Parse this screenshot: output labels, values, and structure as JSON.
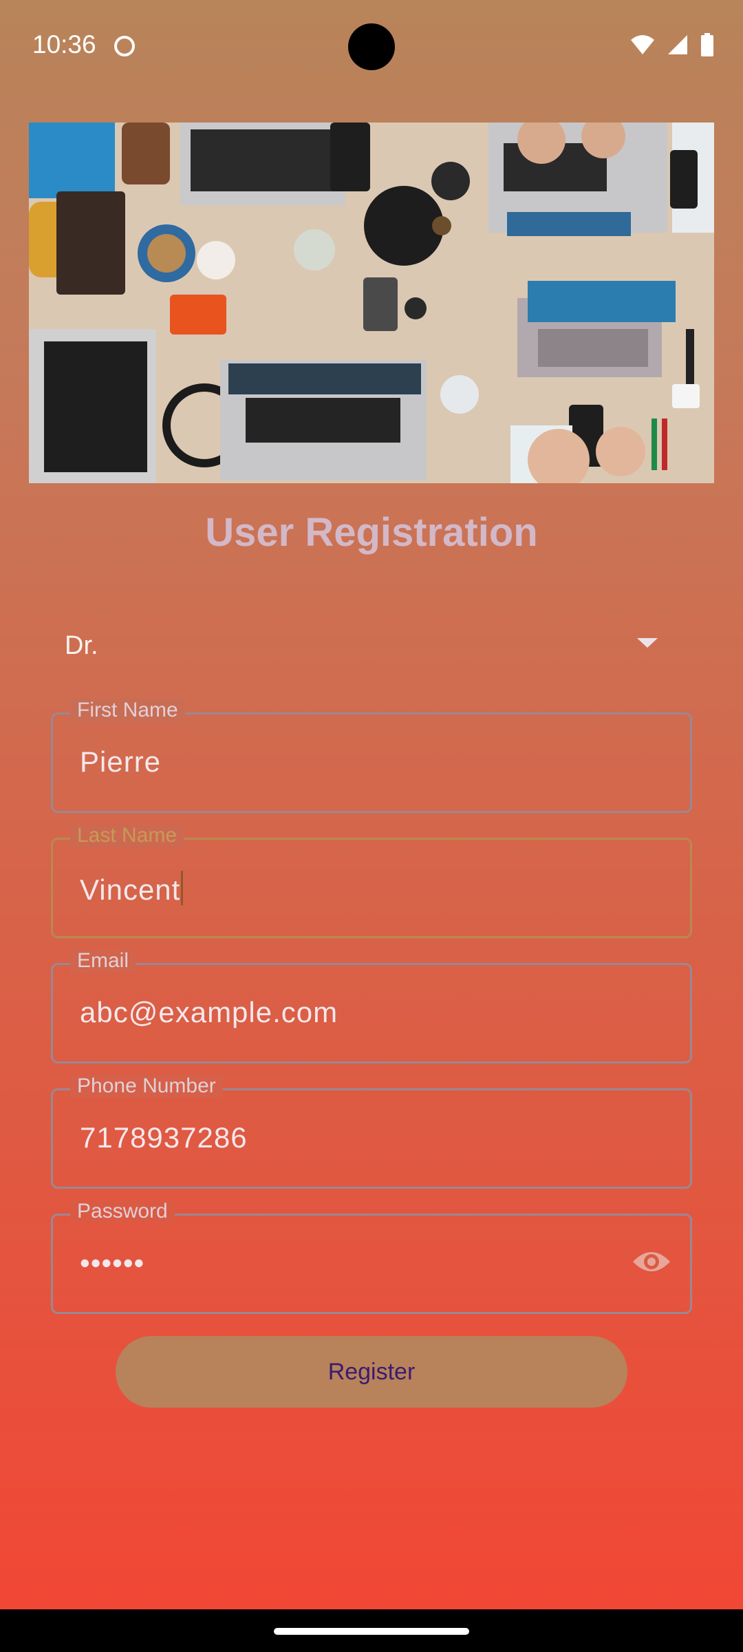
{
  "status_bar": {
    "time": "10:36"
  },
  "hero_image": {
    "description_icon": "office-desk-photo"
  },
  "page": {
    "title": "User Registration"
  },
  "form": {
    "title_dropdown": {
      "value": "Dr."
    },
    "first_name": {
      "label": "First Name",
      "value": "Pierre"
    },
    "last_name": {
      "label": "Last Name",
      "value": "Vincent"
    },
    "email": {
      "label": "Email",
      "value": "abc@example.com"
    },
    "phone": {
      "label": "Phone Number",
      "value": "7178937286"
    },
    "password": {
      "label": "Password",
      "value": "••••••"
    },
    "register_label": "Register"
  },
  "colors": {
    "gradient_top": "#B8845A",
    "gradient_bottom": "#F34534",
    "button": "#B8825A",
    "button_text": "#3A1C6E",
    "focus_outline": "#B9894F"
  }
}
